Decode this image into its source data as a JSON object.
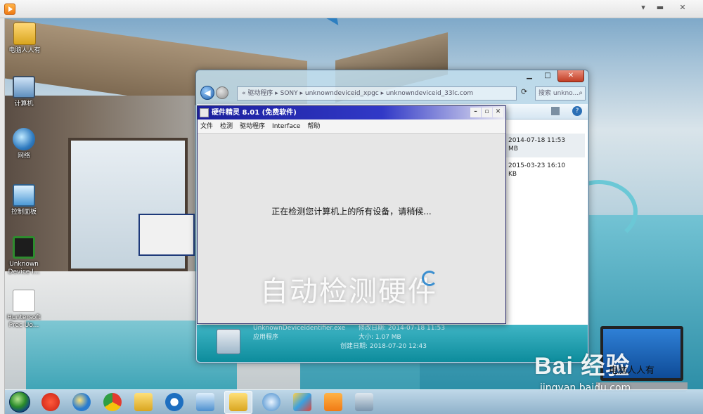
{
  "desktop_icons": [
    {
      "name": "folder",
      "label": "电脑人人有"
    },
    {
      "name": "computer",
      "label": "计算机"
    },
    {
      "name": "network",
      "label": "网络"
    },
    {
      "name": "control-panel",
      "label": "控制面板"
    },
    {
      "name": "unknown-device",
      "label": "Unknown Device I..."
    },
    {
      "name": "doc",
      "label": "Huntersoft Prec Uo..."
    }
  ],
  "explorer": {
    "address": "«  驱动程序 ▸ SONY ▸ unknowndeviceid_xpgc ▸ unknowndeviceid_33lc.com",
    "search_placeholder": "搜索 unkno...",
    "files": [
      {
        "date": "2014-07-18 11:53",
        "size_unit": "MB"
      },
      {
        "date": "2015-03-23 16:10",
        "size_unit": "KB"
      }
    ],
    "details": {
      "filename": "UnknownDeviceIdentifier.exe",
      "modified_label": "修改日期: 2014-07-18 11:53",
      "type": "应用程序",
      "size_label": "大小: 1.07 MB",
      "created_label": "创建日期: 2018-07-20 12:43"
    }
  },
  "dialog": {
    "title": "硬件精灵 8.01 (免费软件)",
    "menu": [
      "文件",
      "检测",
      "驱动程序",
      "Interface",
      "帮助"
    ],
    "message": "正在检测您计算机上的所有设备，请稍候..."
  },
  "overlay_caption": "自动检测硬件",
  "watermark": {
    "brand": "Bai 经验",
    "url": "jingyan.baidu.com",
    "cn_text": "电脑人人有"
  },
  "taskbar_icons": [
    "start-orb",
    "jiang-icon",
    "ie-icon",
    "chrome-icon",
    "folder-icon",
    "search-icon",
    "network-icon",
    "explorer-icon",
    "app-icon",
    "paint-icon",
    "media-icon",
    "tool-icon"
  ],
  "colors": {
    "dialog_title_start": "#1b1f9c",
    "details_pane": "#0d8c9c",
    "close_button": "#c13d24"
  }
}
